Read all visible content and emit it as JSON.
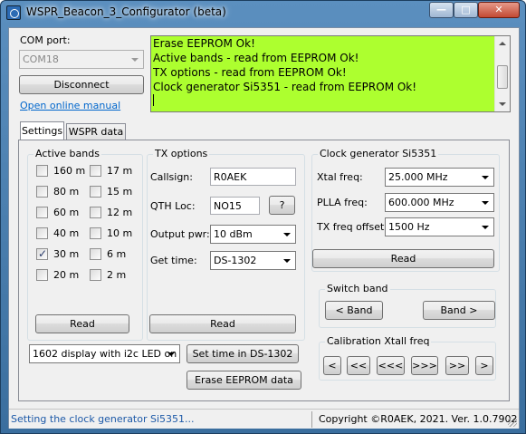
{
  "window": {
    "title": "WSPR_Beacon_3_Configurator (beta)",
    "min": "—",
    "max": "□",
    "close": "✕"
  },
  "com": {
    "label": "COM port:",
    "value": "COM18",
    "disconnect": "Disconnect",
    "manual_link": "Open online manual"
  },
  "log": {
    "lines": [
      "Erase EEPROM Ok!",
      "Active bands - read from EEPROM Ok!",
      "TX options - read from EEPROM Ok!",
      "Clock generator Si5351 - read from EEPROM Ok!"
    ],
    "background": "#adff2f"
  },
  "tabs": [
    {
      "label": "Settings",
      "active": true
    },
    {
      "label": "WSPR data",
      "active": false
    }
  ],
  "bands": {
    "title": "Active bands",
    "col1": [
      {
        "label": "160 m",
        "checked": false
      },
      {
        "label": "80 m",
        "checked": false
      },
      {
        "label": "60 m",
        "checked": false
      },
      {
        "label": "40 m",
        "checked": false
      },
      {
        "label": "30 m",
        "checked": true
      },
      {
        "label": "20 m",
        "checked": false
      }
    ],
    "col2": [
      {
        "label": "17 m",
        "checked": false
      },
      {
        "label": "15 m",
        "checked": false
      },
      {
        "label": "12 m",
        "checked": false
      },
      {
        "label": "10 m",
        "checked": false
      },
      {
        "label": "6 m",
        "checked": false
      },
      {
        "label": "2 m",
        "checked": false
      }
    ],
    "read": "Read"
  },
  "tx": {
    "title": "TX options",
    "callsign_label": "Callsign:",
    "callsign": "R0AEK",
    "qth_label": "QTH Loc:",
    "qth": "NO15",
    "qth_help": "?",
    "pwr_label": "Output pwr:",
    "pwr": "10 dBm",
    "time_label": "Get time:",
    "time": "DS-1302",
    "read": "Read"
  },
  "clock": {
    "title": "Clock generator Si5351",
    "xtal_label": "Xtal freq:",
    "xtal": "25.000 MHz",
    "plla_label": "PLLA freq:",
    "plla": "600.000 MHz",
    "offset_label": "TX freq offset:",
    "offset": "1500 Hz",
    "read": "Read"
  },
  "switch_band": {
    "title": "Switch band",
    "prev": "< Band",
    "next": "Band >"
  },
  "calibration": {
    "title": "Calibration Xtall freq",
    "buttons": [
      "<",
      "<<",
      "<<<",
      ">>>",
      ">>",
      ">"
    ]
  },
  "display": {
    "value": "1602 display with i2c LED on",
    "set_time": "Set time in DS-1302",
    "erase": "Erase EEPROM data"
  },
  "status": {
    "left": "Setting the clock generator Si5351...",
    "right": "Copyright ©R0AEK, 2021. Ver. 1.0.7902",
    "left_color": "#1e5aa8"
  }
}
